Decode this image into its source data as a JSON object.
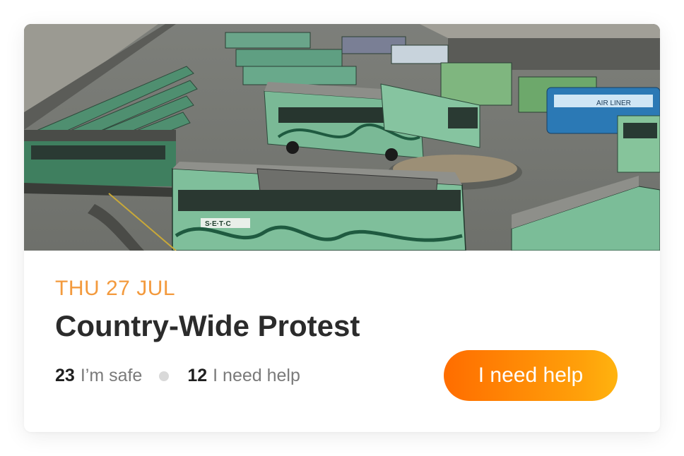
{
  "event": {
    "date": "THU 27 JUL",
    "title": "Country-Wide Protest"
  },
  "stats": {
    "safe_count": "23",
    "safe_label": "I’m safe",
    "help_count": "12",
    "help_label": "I need help"
  },
  "action": {
    "button_label": "I need help"
  },
  "colors": {
    "date_accent": "#f39a3d",
    "button_gradient_start": "#ff6d00",
    "button_gradient_end": "#ffb30f",
    "title_text": "#2b2b2b",
    "muted_text": "#7a7a7a"
  },
  "photo": {
    "bus_side_text": "S·E·T·C",
    "far_bus_text": "AIR LINER"
  }
}
